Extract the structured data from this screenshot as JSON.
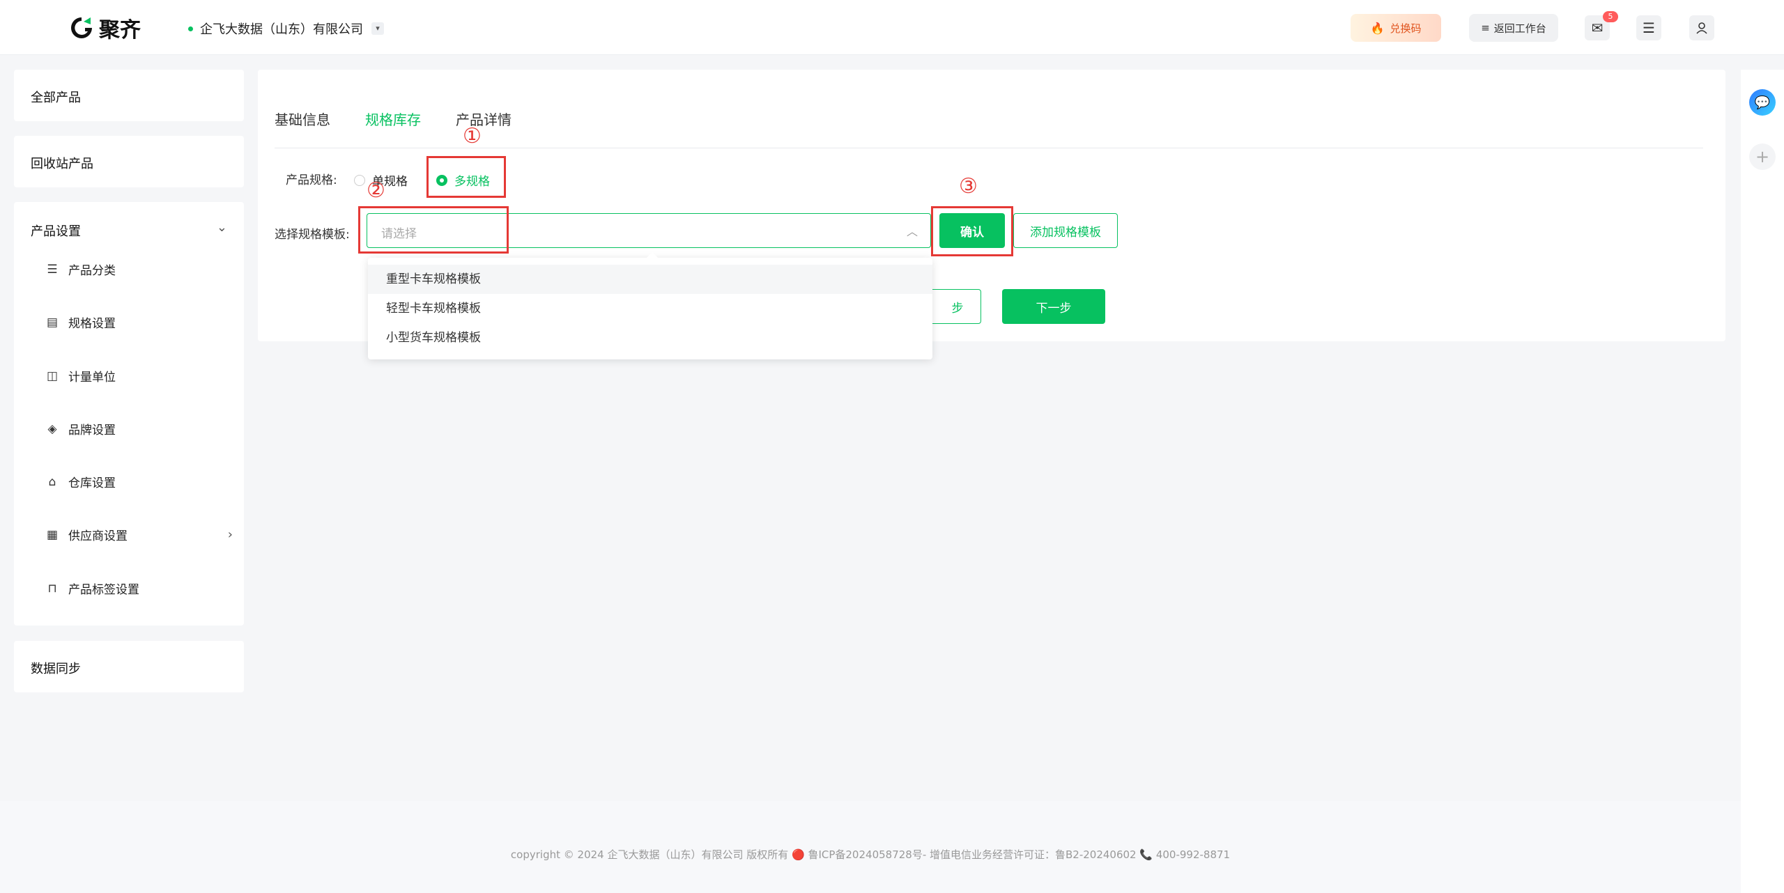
{
  "header": {
    "logo_text": "聚齐",
    "company": "企飞大数据（山东）有限公司",
    "redeem": "兑换码",
    "workbench": "返回工作台",
    "mail_badge": "5"
  },
  "sidebar": {
    "all_products": "全部产品",
    "recycle": "回收站产品",
    "settings": "产品设置",
    "items": [
      {
        "label": "产品分类",
        "icon": "list-icon"
      },
      {
        "label": "规格设置",
        "icon": "spec-icon"
      },
      {
        "label": "计量单位",
        "icon": "unit-icon"
      },
      {
        "label": "品牌设置",
        "icon": "tag-icon"
      },
      {
        "label": "仓库设置",
        "icon": "warehouse-icon"
      },
      {
        "label": "供应商设置",
        "icon": "supplier-icon"
      },
      {
        "label": "产品标签设置",
        "icon": "bookmark-icon"
      }
    ],
    "sync": "数据同步"
  },
  "tabs": [
    "基础信息",
    "规格库存",
    "产品详情"
  ],
  "active_tab": "规格库存",
  "form": {
    "spec_label": "产品规格:",
    "single": "单规格",
    "multi": "多规格",
    "template_label": "选择规格模板:",
    "placeholder": "请选择",
    "confirm": "确认",
    "add_template": "添加规格模板",
    "prev": "上一步",
    "prev_visible": "步",
    "next": "下一步"
  },
  "dropdown_options": [
    "重型卡车规格模板",
    "轻型卡车规格模板",
    "小型货车规格模板"
  ],
  "annotations": [
    "①",
    "②",
    "③"
  ],
  "footer": "copyright © 2024 企飞大数据（山东）有限公司 版权所有  🔴 鲁ICP备2024058728号-  增值电信业务经营许可证：鲁B2-20240602 📞 400-992-8871",
  "colors": {
    "accent": "#07c160",
    "annotation": "#e53935"
  }
}
